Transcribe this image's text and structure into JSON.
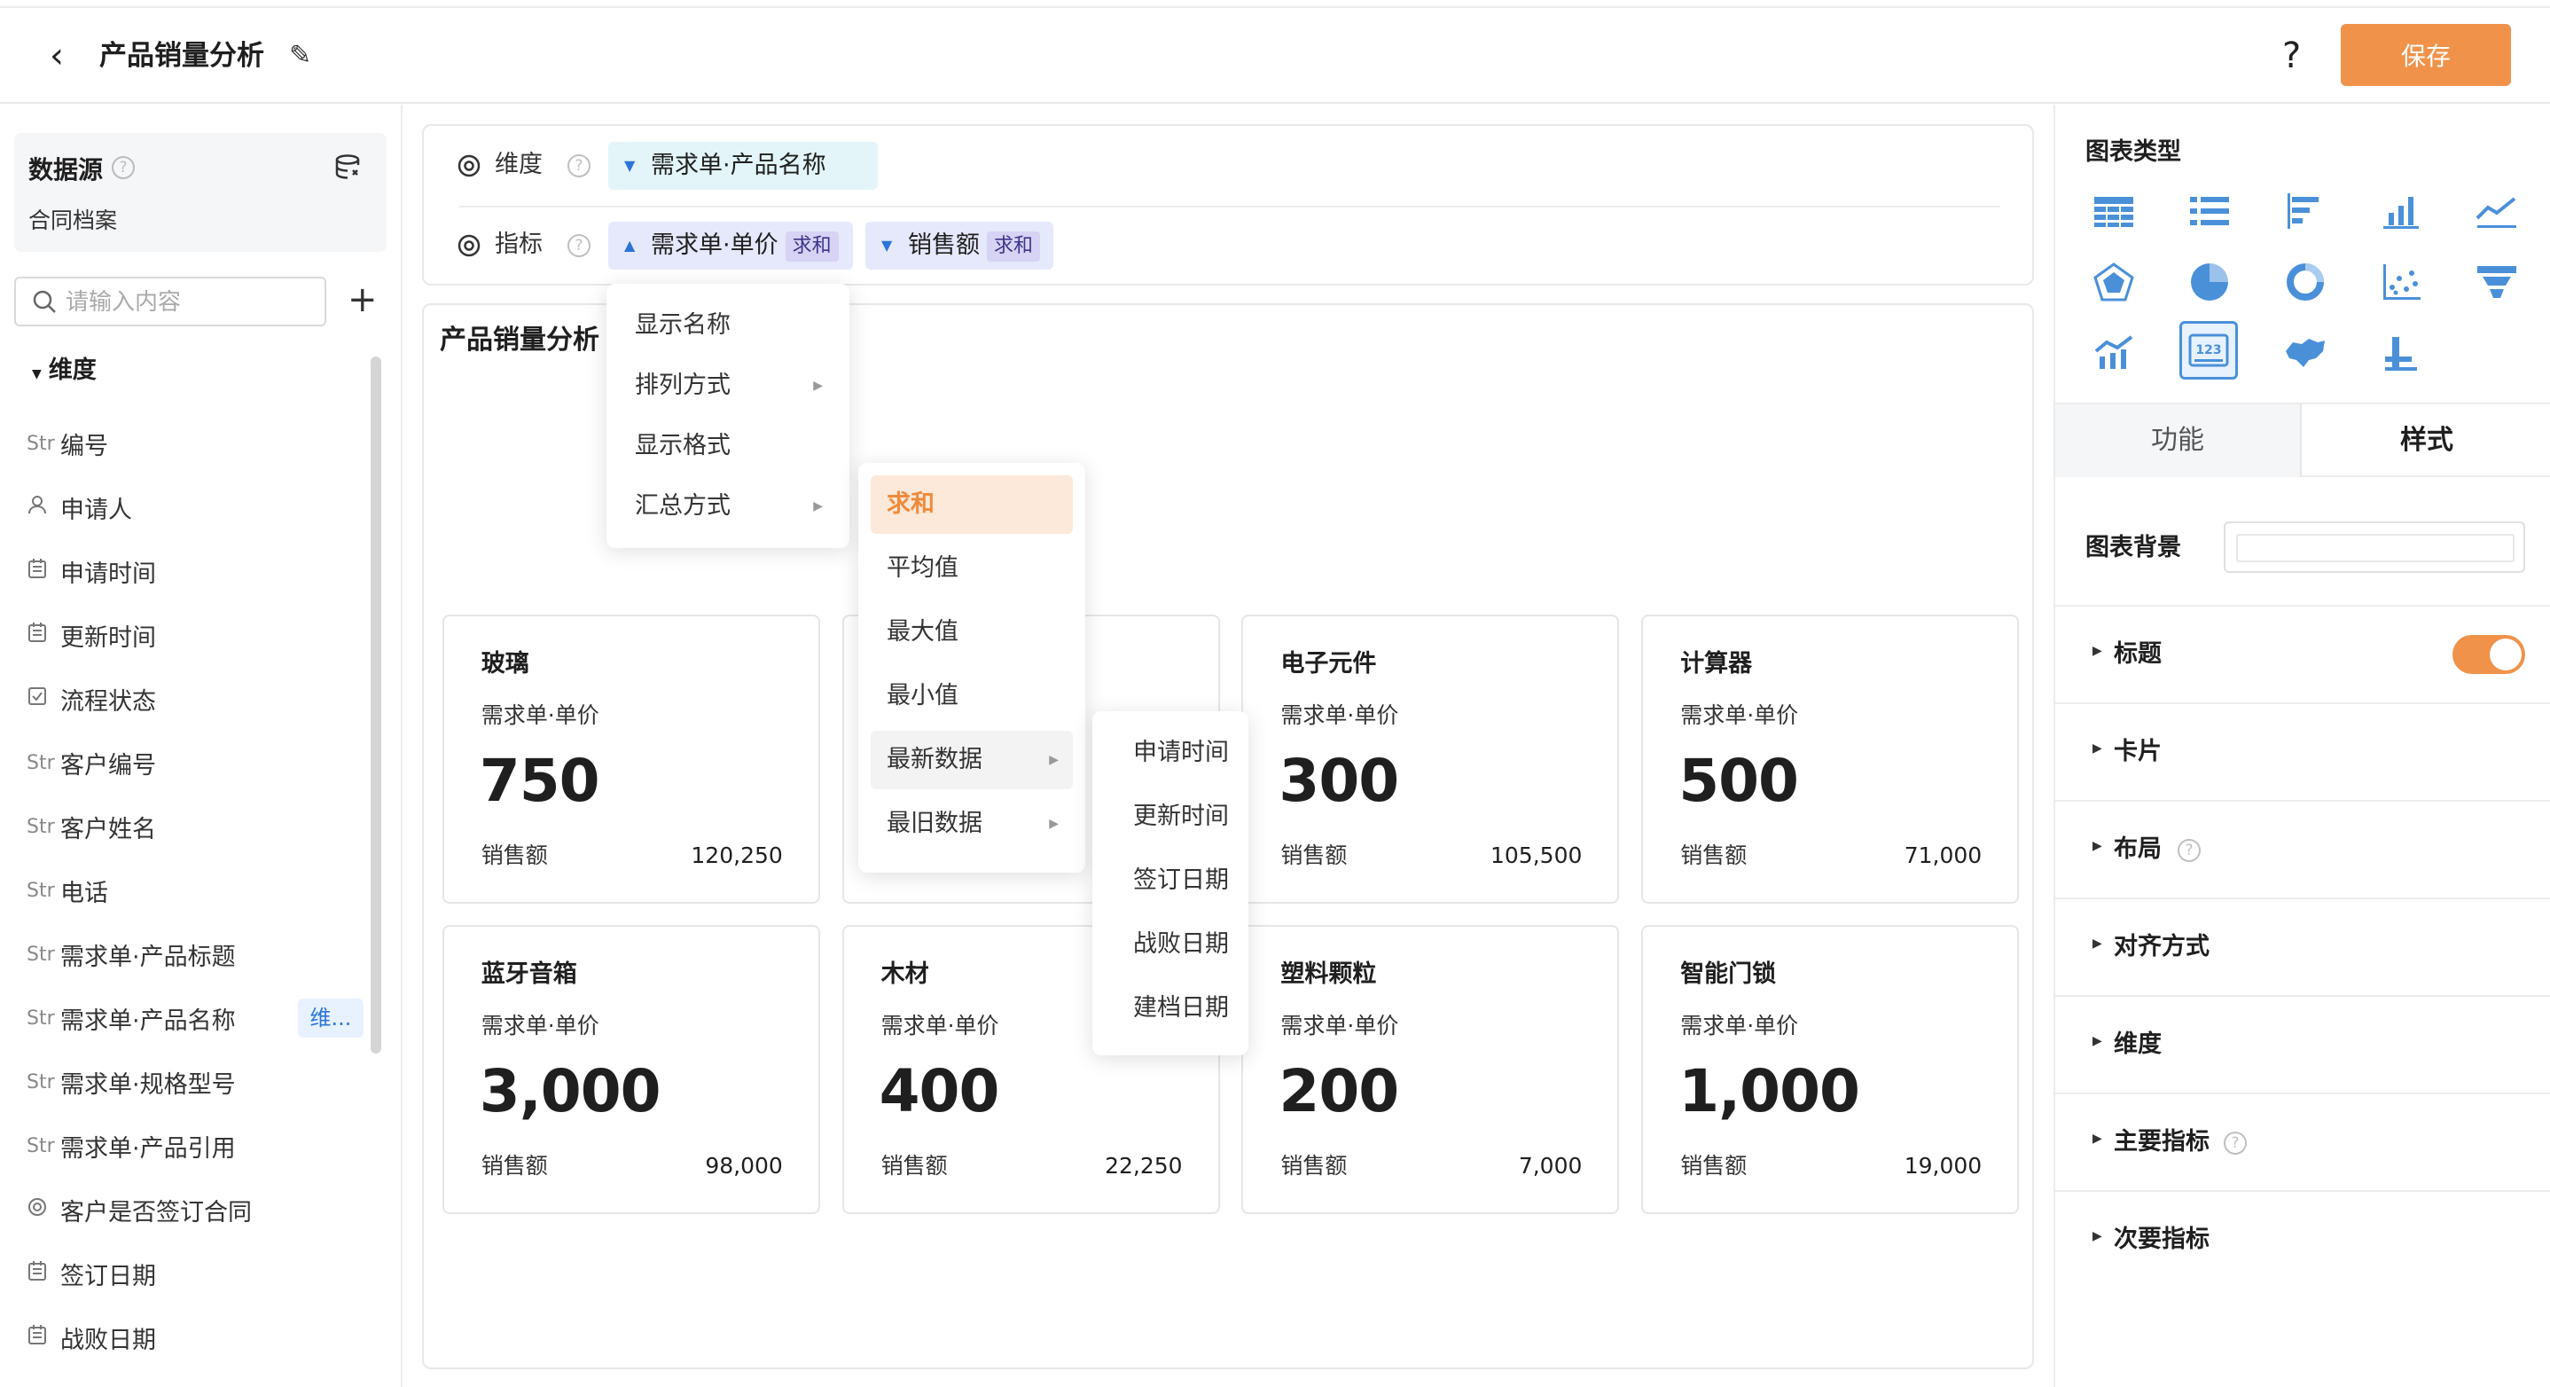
{
  "header": {
    "title": "产品销量分析",
    "back_icon": "chevron-left-icon",
    "edit_icon": "pencil-icon",
    "help_label": "?",
    "save_label": "保存"
  },
  "left": {
    "datasource_label": "数据源",
    "datasource_name": "合同档案",
    "help_glyph": "?",
    "search_placeholder": "请输入内容",
    "add_glyph": "+",
    "dimension_heading": "维度",
    "fields": [
      {
        "type": "Str",
        "label": "编号"
      },
      {
        "type": "user",
        "label": "申请人"
      },
      {
        "type": "date",
        "label": "申请时间"
      },
      {
        "type": "date",
        "label": "更新时间"
      },
      {
        "type": "check",
        "label": "流程状态"
      },
      {
        "type": "Str",
        "label": "客户编号"
      },
      {
        "type": "Str",
        "label": "客户姓名"
      },
      {
        "type": "Str",
        "label": "电话"
      },
      {
        "type": "Str",
        "label": "需求单·产品标题"
      },
      {
        "type": "Str",
        "label": "需求单·产品名称",
        "badge": "维..."
      },
      {
        "type": "Str",
        "label": "需求单·规格型号"
      },
      {
        "type": "Str",
        "label": "需求单·产品引用"
      },
      {
        "type": "radio",
        "label": "客户是否签订合同"
      },
      {
        "type": "date",
        "label": "签订日期"
      },
      {
        "type": "date",
        "label": "战败日期"
      }
    ]
  },
  "config": {
    "dimension_label": "维度",
    "metric_label": "指标",
    "help_glyph": "?",
    "dimension_chip": "需求单·产品名称",
    "metric_chips": [
      {
        "label": "需求单·单价",
        "agg": "求和"
      },
      {
        "label": "销售额",
        "agg": "求和"
      }
    ]
  },
  "chart": {
    "title": "产品销量分析",
    "cards": [
      {
        "name": "玻璃",
        "metric": "需求单·单价",
        "value": "750",
        "sub_label": "销售额",
        "sub_value": "120,250"
      },
      {
        "name": "",
        "metric": "",
        "value": "",
        "sub_label": "",
        "sub_value": ""
      },
      {
        "name": "电子元件",
        "metric": "需求单·单价",
        "value": "300",
        "sub_label": "销售额",
        "sub_value": "105,500"
      },
      {
        "name": "计算器",
        "metric": "需求单·单价",
        "value": "500",
        "sub_label": "销售额",
        "sub_value": "71,000"
      },
      {
        "name": "蓝牙音箱",
        "metric": "需求单·单价",
        "value": "3,000",
        "sub_label": "销售额",
        "sub_value": "98,000"
      },
      {
        "name": "木材",
        "metric": "需求单·单价",
        "value": "400",
        "sub_label": "销售额",
        "sub_value": "22,250"
      },
      {
        "name": "塑料颗粒",
        "metric": "需求单·单价",
        "value": "200",
        "sub_label": "销售额",
        "sub_value": "7,000"
      },
      {
        "name": "智能门锁",
        "metric": "需求单·单价",
        "value": "1,000",
        "sub_label": "销售额",
        "sub_value": "19,000"
      }
    ]
  },
  "menus": {
    "main": [
      "显示名称",
      "排列方式",
      "显示格式",
      "汇总方式"
    ],
    "aggregation": [
      "求和",
      "平均值",
      "最大值",
      "最小值",
      "最新数据",
      "最旧数据"
    ],
    "date_fields": [
      "申请时间",
      "更新时间",
      "签订日期",
      "战败日期",
      "建档日期"
    ]
  },
  "right": {
    "chart_type_title": "图表类型",
    "tabs": [
      "功能",
      "样式"
    ],
    "bg_label": "图表背景",
    "sections": [
      {
        "label": "标题",
        "toggle": true
      },
      {
        "label": "卡片"
      },
      {
        "label": "布局",
        "help": true
      },
      {
        "label": "对齐方式"
      },
      {
        "label": "维度"
      },
      {
        "label": "主要指标",
        "help": true
      },
      {
        "label": "次要指标"
      }
    ],
    "selected_chart_type": "kpi-card"
  },
  "colors": {
    "accent": "#f0924a",
    "dim_chip": "#e3f5f8",
    "metric_chip": "#e6e8fb",
    "chart_icon": "#4a90d9"
  }
}
